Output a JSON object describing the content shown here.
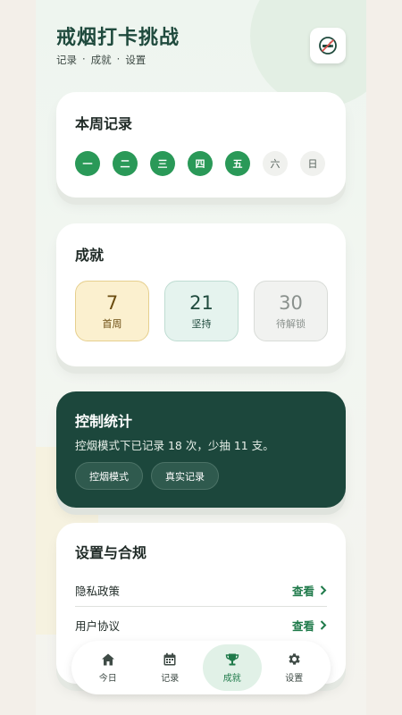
{
  "header": {
    "title": "戒烟打卡挑战",
    "nav": [
      "记录",
      "成就",
      "设置"
    ],
    "separator": "·",
    "icon": "no-smoking-icon"
  },
  "week": {
    "title": "本周记录",
    "days": [
      {
        "label": "一",
        "checked": true
      },
      {
        "label": "二",
        "checked": true
      },
      {
        "label": "三",
        "checked": true
      },
      {
        "label": "四",
        "checked": true
      },
      {
        "label": "五",
        "checked": true
      },
      {
        "label": "六",
        "checked": false
      },
      {
        "label": "日",
        "checked": false
      }
    ]
  },
  "achievements": {
    "title": "成就",
    "badges": [
      {
        "num": "7",
        "label": "首周"
      },
      {
        "num": "21",
        "label": "坚持"
      },
      {
        "num": "30",
        "label": "待解锁"
      }
    ]
  },
  "control": {
    "title": "控制统计",
    "text": "控烟模式下已记录 18 次，少抽 11 支。",
    "buttons": [
      "控烟模式",
      "真实记录"
    ]
  },
  "settings": {
    "title": "设置与合规",
    "rows": [
      {
        "label": "隐私政策",
        "action": "查看"
      },
      {
        "label": "用户协议",
        "action": "查看"
      }
    ]
  },
  "tabs": [
    {
      "label": "今日",
      "icon": "home-icon"
    },
    {
      "label": "记录",
      "icon": "calendar-icon"
    },
    {
      "label": "成就",
      "icon": "trophy-icon",
      "active": true
    },
    {
      "label": "设置",
      "icon": "gear-icon"
    }
  ],
  "colors": {
    "accent": "#2a9958",
    "dark_card": "#1c473c",
    "link": "#1f7a4a"
  }
}
